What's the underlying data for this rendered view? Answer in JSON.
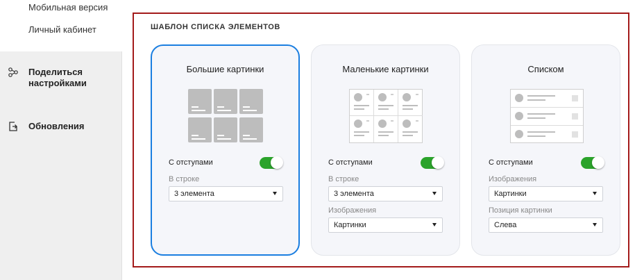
{
  "sidebar": {
    "sub_items": [
      "Мобильная версия",
      "Личный кабинет"
    ],
    "items": [
      {
        "label": "Поделиться настройками",
        "icon": "share-icon"
      },
      {
        "label": "Обновления",
        "icon": "update-icon"
      }
    ]
  },
  "section": {
    "title": "ШАБЛОН СПИСКА ЭЛЕМЕНТОВ",
    "accent_color": "#a31a1a",
    "selected_color": "#1a7ee0",
    "toggle_color": "#2ba32b"
  },
  "cards": [
    {
      "title": "Большие картинки",
      "selected": true,
      "toggle_label": "С отступами",
      "toggle_on": true,
      "fields": [
        {
          "label": "В строке",
          "value": "3 элемента"
        }
      ]
    },
    {
      "title": "Маленькие картинки",
      "selected": false,
      "toggle_label": "С отступами",
      "toggle_on": true,
      "fields": [
        {
          "label": "В строке",
          "value": "3 элемента"
        },
        {
          "label": "Изображения",
          "value": "Картинки"
        }
      ]
    },
    {
      "title": "Списком",
      "selected": false,
      "toggle_label": "С отступами",
      "toggle_on": true,
      "fields": [
        {
          "label": "Изображения",
          "value": "Картинки"
        },
        {
          "label": "Позиция картинки",
          "value": "Слева"
        }
      ]
    }
  ]
}
